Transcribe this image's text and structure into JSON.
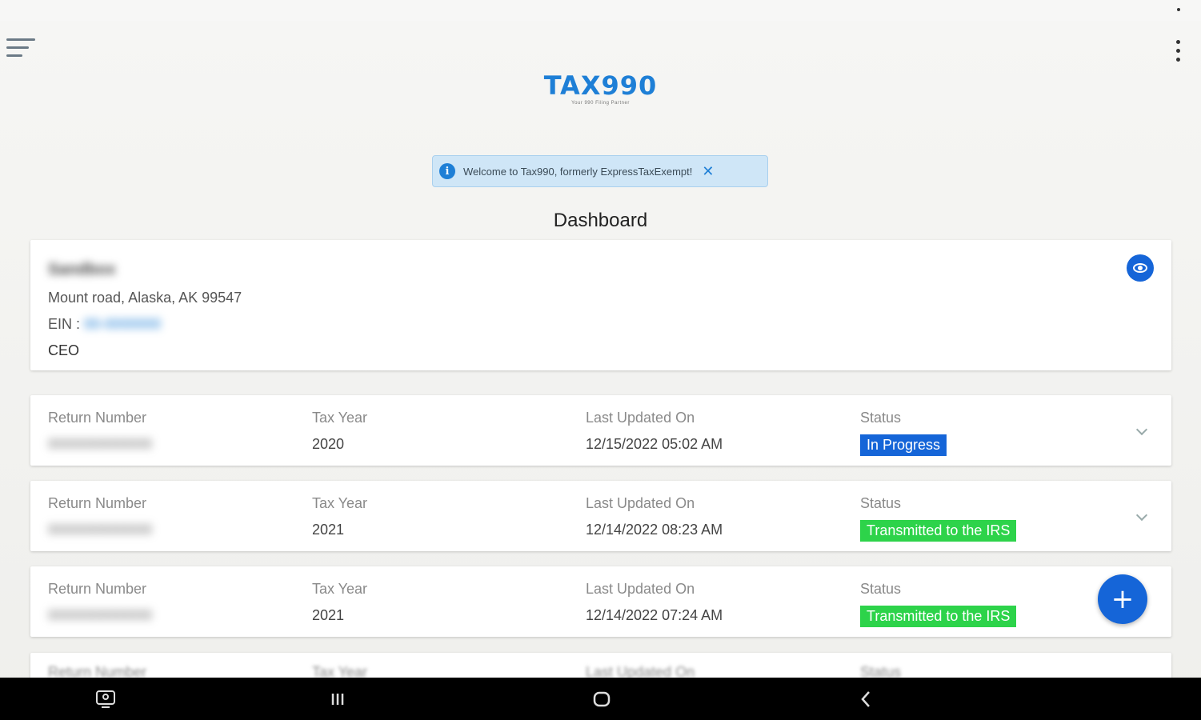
{
  "app": {
    "logo_text": "TAX990",
    "logo_tagline": "Your 990 Filing Partner"
  },
  "banner": {
    "info_glyph": "i",
    "text": "Welcome to Tax990, formerly ExpressTaxExempt!",
    "close_glyph": "✕"
  },
  "page": {
    "title": "Dashboard"
  },
  "organization": {
    "name": "Sandbox",
    "address": "Mount road, Alaska, AK 99547",
    "ein_label": "EIN :",
    "ein_value": "00-0000000",
    "role": "CEO"
  },
  "columns": {
    "return_number": "Return Number",
    "tax_year": "Tax Year",
    "last_updated": "Last Updated On",
    "status": "Status"
  },
  "returns": [
    {
      "return_number": "0000000000000",
      "tax_year": "2020",
      "last_updated": "12/15/2022 05:02 AM",
      "status": "In Progress"
    },
    {
      "return_number": "0000000000000",
      "tax_year": "2021",
      "last_updated": "12/14/2022 08:23 AM",
      "status": "Transmitted to the IRS"
    },
    {
      "return_number": "0000000000000",
      "tax_year": "2021",
      "last_updated": "12/14/2022 07:24 AM",
      "status": "Transmitted to the IRS"
    }
  ],
  "fab": {
    "glyph": "+"
  },
  "icons": {
    "menu": "hamburger-menu-icon",
    "overflow": "more-vertical-icon",
    "view": "eye-icon",
    "expand": "chevron-down-icon"
  },
  "colors": {
    "brand_blue": "#1e7fd6",
    "in_progress": "#1565d8",
    "transmitted": "#2dd34a",
    "banner_bg": "#cfe6f7"
  }
}
